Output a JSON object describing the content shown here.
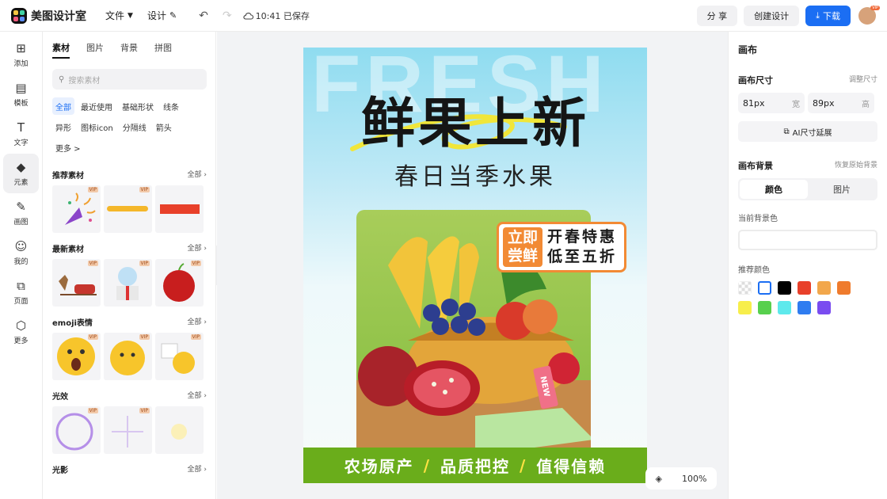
{
  "app": {
    "name": "美图设计室"
  },
  "topbar": {
    "file_label": "文件",
    "design_label": "设计",
    "save_status": "10:41 已保存",
    "share_label": "分 享",
    "create_label": "创建设计",
    "download_label": "下载",
    "avatar_badge": "VIP"
  },
  "rail": [
    {
      "label": "添加",
      "icon": "plus-square-icon",
      "glyph": "⊞"
    },
    {
      "label": "模板",
      "icon": "template-icon",
      "glyph": "▤"
    },
    {
      "label": "文字",
      "icon": "text-icon",
      "glyph": "T"
    },
    {
      "label": "元素",
      "icon": "shapes-icon",
      "glyph": "◆"
    },
    {
      "label": "画图",
      "icon": "draw-icon",
      "glyph": "✎"
    },
    {
      "label": "我的",
      "icon": "user-icon",
      "glyph": "☺"
    },
    {
      "label": "页面",
      "icon": "page-add-icon",
      "glyph": "⧉"
    },
    {
      "label": "更多",
      "icon": "cube-icon",
      "glyph": "⬡"
    }
  ],
  "panel": {
    "tabs": [
      "素材",
      "图片",
      "背景",
      "拼图"
    ],
    "search_placeholder": "搜索素材",
    "chips": [
      "全部",
      "最近使用",
      "基础形状",
      "线条",
      "异形",
      "图标icon",
      "分隔线",
      "箭头",
      "更多 >"
    ],
    "see_all": "全部",
    "vip_tag": "VIP",
    "sections": [
      {
        "title": "推荐素材"
      },
      {
        "title": "最新素材"
      },
      {
        "title": "emoji表情"
      },
      {
        "title": "光效"
      },
      {
        "title": "光影"
      }
    ]
  },
  "poster": {
    "watermark": "FRESH",
    "title": "鲜果上新",
    "subtitle": "春日当季水果",
    "promo_left_1": "立即",
    "promo_left_2": "尝鲜",
    "promo_right_1": "开春特惠",
    "promo_right_2": "低至五折",
    "tag": "NEW",
    "bottom_1": "农场原产",
    "bottom_2": "品质把控",
    "bottom_3": "值得信赖",
    "separator": "/"
  },
  "zoom": {
    "value": "100%"
  },
  "right": {
    "title": "画布",
    "size_label": "画布尺寸",
    "adjust_size": "调整尺寸",
    "width_value": "81px",
    "width_unit": "宽",
    "height_value": "89px",
    "height_unit": "高",
    "ai_extend": "AI尺寸延展",
    "bg_label": "画布背景",
    "restore_bg": "恢复原始背景",
    "seg_color": "颜色",
    "seg_image": "图片",
    "current_bg": "当前背景色",
    "recommended": "推荐颜色",
    "swatches": [
      "transparent",
      "#ffffff",
      "#000000",
      "#e8402a",
      "#f2a74b",
      "#ef7b2d",
      "#f7ee4b",
      "#57d04d",
      "#5ee9ec",
      "#2f7cf0",
      "#7a4cf0"
    ]
  }
}
